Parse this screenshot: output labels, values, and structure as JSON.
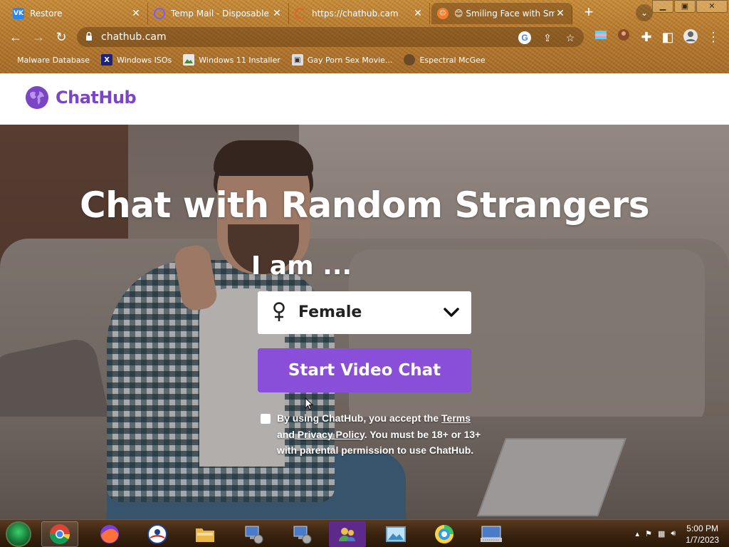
{
  "browser": {
    "tabs": [
      {
        "title": "Restore",
        "favicon": "vk-icon",
        "color": "#2787f5"
      },
      {
        "title": "Temp Mail - Disposable Te",
        "favicon": "temp-mail-icon",
        "color": "#7b5cff"
      },
      {
        "title": "https://chathub.cam",
        "favicon": "loading-icon",
        "color": "#e4632b"
      },
      {
        "title": "😊 Smiling Face with Smil",
        "favicon": "emoji-icon",
        "color": "#f57c2a"
      }
    ],
    "url": "chathub.cam",
    "bookmarks": [
      {
        "label": "Malware Database",
        "icon": "bookmark-icon"
      },
      {
        "label": "Windows ISOs",
        "icon": "x-icon"
      },
      {
        "label": "Windows 11 Installer",
        "icon": "image-icon"
      },
      {
        "label": "Gay Porn Sex Movie...",
        "icon": "box-icon"
      },
      {
        "label": "Espectral McGee",
        "icon": "avatar-icon"
      }
    ]
  },
  "site": {
    "logo_text": "ChatHub",
    "brand_color": "#7b46c5",
    "hero_title": "Chat with Random Strangers",
    "iam_label": "I am ...",
    "gender_selected": "Female",
    "start_button": "Start Video Chat",
    "terms": {
      "prefix": "By using ChatHub, you accept the",
      "terms_link": "Terms",
      "and": "and",
      "privacy_link": "Privacy Policy",
      "suffix": ". You must be 18+ or 13+ with parental permission to use ChatHub."
    }
  },
  "taskbar": {
    "apps": [
      "chrome-icon",
      "firefox-icon",
      "obama-logo-icon",
      "file-explorer-icon",
      "network-setup-icon",
      "network-setup-icon",
      "users-icon",
      "photos-icon",
      "browser-icon",
      "keyboard-icon"
    ],
    "time": "5:00 PM",
    "date": "1/7/2023"
  }
}
